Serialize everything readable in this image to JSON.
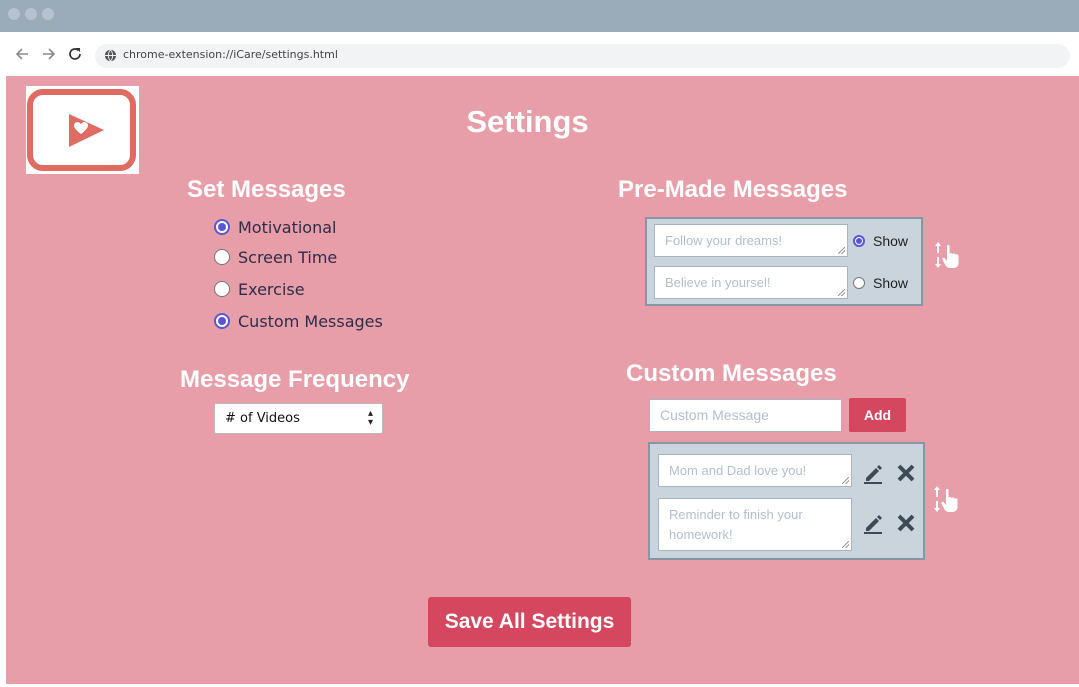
{
  "browser": {
    "url": "chrome-extension://iCare/settings.html"
  },
  "page": {
    "title": "Settings"
  },
  "set_messages": {
    "heading": "Set Messages",
    "options": [
      {
        "label": "Motivational",
        "checked": true
      },
      {
        "label": "Screen Time",
        "checked": false
      },
      {
        "label": "Exercise",
        "checked": false
      },
      {
        "label": "Custom Messages",
        "checked": true
      }
    ]
  },
  "frequency": {
    "heading": "Message Frequency",
    "selected": "# of Videos"
  },
  "premade": {
    "heading": "Pre-Made Messages",
    "items": [
      {
        "placeholder": "Follow your dreams!",
        "show_label": "Show",
        "shown": true
      },
      {
        "placeholder": "Believe in yoursel!",
        "show_label": "Show",
        "shown": false
      }
    ]
  },
  "custom": {
    "heading": "Custom Messages",
    "input_placeholder": "Custom Message",
    "add_label": "Add",
    "items": [
      {
        "placeholder": "Mom and Dad love you!"
      },
      {
        "placeholder": "Reminder to finish your homework!"
      }
    ]
  },
  "save_label": "Save All Settings",
  "colors": {
    "page_bg": "#e89ea9",
    "accent": "#d5475f",
    "radio": "#5b55d6",
    "panel": "#c9d4dd"
  },
  "icons": [
    "back-icon",
    "forward-icon",
    "reload-icon",
    "globe-icon",
    "logo-icon",
    "pencil-icon",
    "close-icon",
    "drag-reorder-icon"
  ]
}
